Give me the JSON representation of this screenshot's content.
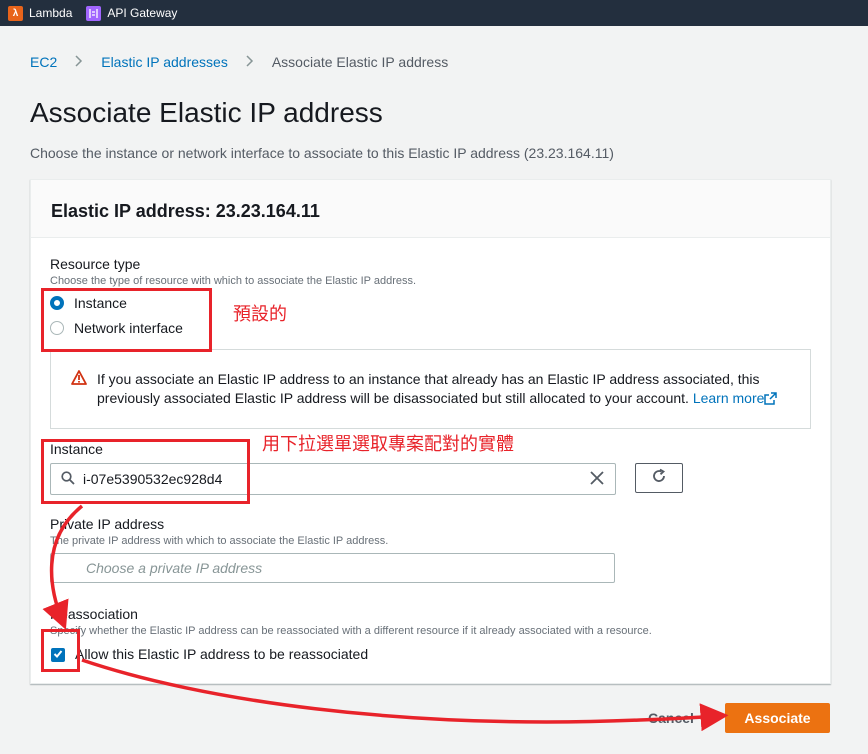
{
  "topbar": {
    "favorites": [
      {
        "label": "Lambda",
        "icon": "lambda-icon",
        "color": "#e8641b"
      },
      {
        "label": "API Gateway",
        "icon": "api-gateway-icon",
        "color": "#a166ff"
      }
    ]
  },
  "breadcrumb": {
    "items": [
      "EC2",
      "Elastic IP addresses"
    ],
    "current": "Associate Elastic IP address"
  },
  "page": {
    "title": "Associate Elastic IP address",
    "description": "Choose the instance or network interface to associate to this Elastic IP address (23.23.164.11)"
  },
  "panel": {
    "header": "Elastic IP address: 23.23.164.11",
    "resource_type": {
      "label": "Resource type",
      "hint": "Choose the type of resource with which to associate the Elastic IP address.",
      "options": [
        "Instance",
        "Network interface"
      ],
      "selected": "Instance"
    },
    "alert": {
      "text": "If you associate an Elastic IP address to an instance that already has an Elastic IP address associated, this previously associated Elastic IP address will be disassociated but still allocated to your account.",
      "link": "Learn more"
    },
    "instance": {
      "label": "Instance",
      "value": "i-07e5390532ec928d4"
    },
    "private_ip": {
      "label": "Private IP address",
      "hint": "The private IP address with which to associate the Elastic IP address.",
      "placeholder": "Choose a private IP address"
    },
    "reassociation": {
      "label": "Reassociation",
      "hint": "Specify whether the Elastic IP address can be reassociated with a different resource if it already associated with a resource.",
      "checkbox_label": "Allow this Elastic IP address to be reassociated",
      "checked": true
    }
  },
  "footer": {
    "cancel_label": "Cancel",
    "associate_label": "Associate"
  },
  "annotations": {
    "default_note": "預設的",
    "instance_note": "用下拉選單選取專案配對的實體"
  },
  "colors": {
    "accent": "#0073bb",
    "primary_button": "#ec7211",
    "annotation": "#e8232a",
    "warning": "#d13212"
  }
}
